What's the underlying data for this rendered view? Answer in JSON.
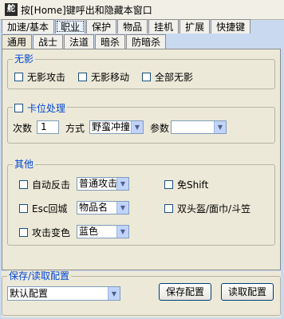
{
  "window": {
    "title": "按[Home]键呼出和隐藏本窗口",
    "icon_glyph": "舵"
  },
  "tabs_row1": [
    {
      "label": "加速/基本"
    },
    {
      "label": "职业"
    },
    {
      "label": "保护"
    },
    {
      "label": "物品"
    },
    {
      "label": "挂机"
    },
    {
      "label": "扩展"
    },
    {
      "label": "快捷键"
    }
  ],
  "tabs_row2": [
    {
      "label": "通用"
    },
    {
      "label": "战士"
    },
    {
      "label": "法道"
    },
    {
      "label": "暗杀"
    },
    {
      "label": "防暗杀"
    }
  ],
  "noshadow": {
    "legend": "无影",
    "attack": "无影攻击",
    "move": "无影移动",
    "all": "全部无影"
  },
  "stuck": {
    "legend": "卡位处理",
    "count_label": "次数",
    "count_value": "1",
    "method_label": "方式",
    "method_value": "野蛮冲撞",
    "param_label": "参数",
    "param_value": ""
  },
  "other": {
    "legend": "其他",
    "auto_counter": "自动反击",
    "auto_counter_value": "普通攻击",
    "esc_return": "Esc回城",
    "esc_return_value": "物品名",
    "attack_color": "攻击变色",
    "attack_color_value": "蓝色",
    "no_shift": "免Shift",
    "double_head": "双头盔/面巾/斗笠"
  },
  "config": {
    "legend": "保存/读取配置",
    "selected": "默认配置",
    "save_button": "保存配置",
    "load_button": "读取配置"
  }
}
